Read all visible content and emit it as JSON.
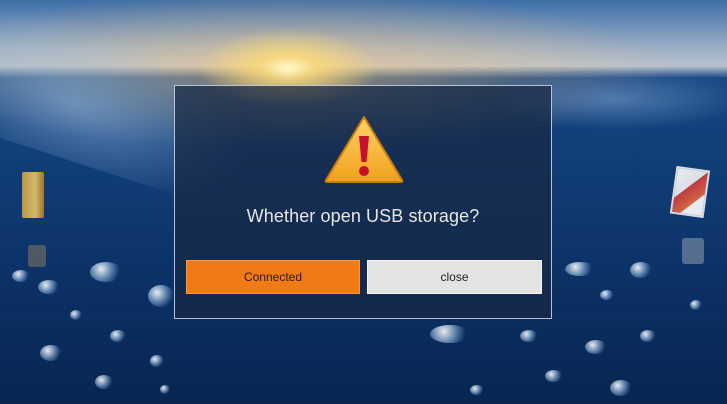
{
  "dialog": {
    "message": "Whether open USB storage?",
    "icon": "warning-icon",
    "buttons": {
      "connected_label": "Connected",
      "close_label": "close"
    }
  },
  "colors": {
    "accent": "#f07a14",
    "secondary_button": "#e3e3e3",
    "warning_yellow": "#f5a623",
    "warning_red": "#c8102e"
  },
  "desktop_icons": [
    "folder-icon",
    "photo-icon"
  ]
}
